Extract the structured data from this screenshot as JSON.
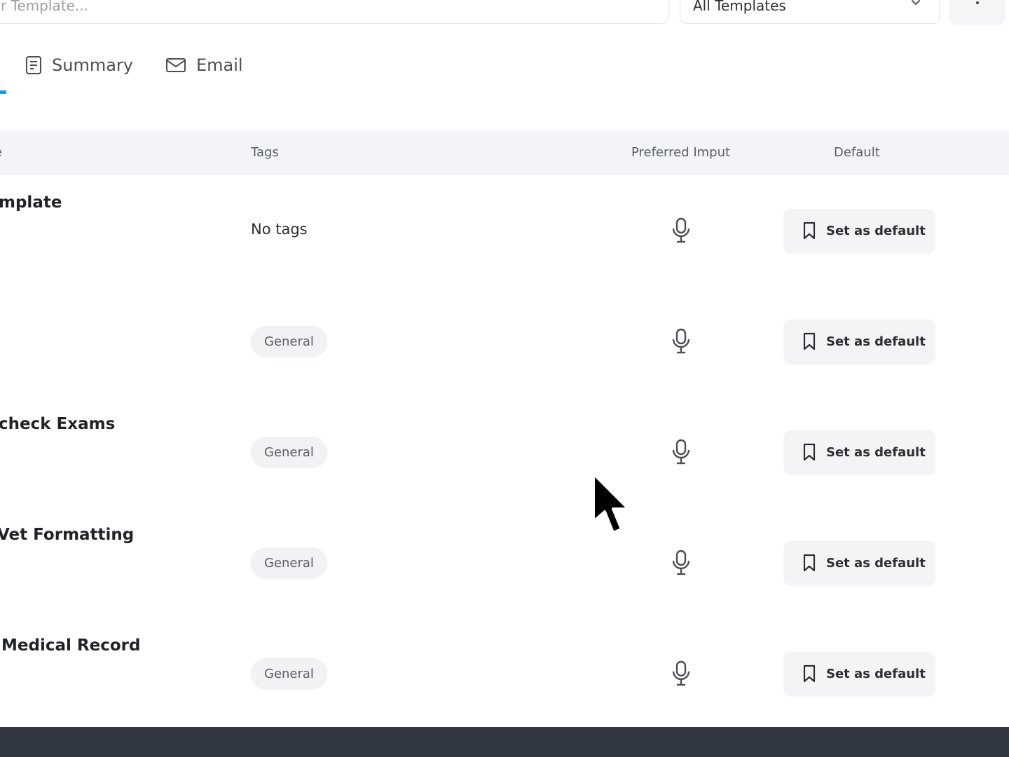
{
  "search": {
    "placeholder": "r Template..."
  },
  "filter": {
    "value": "All Templates"
  },
  "tabs": [
    {
      "label": "Summary",
      "icon": "document-icon"
    },
    {
      "label": "Email",
      "icon": "mail-icon"
    }
  ],
  "table": {
    "headers": {
      "name": "e",
      "tags": "Tags",
      "preferred_input": "Preferred Imput",
      "default": "Default"
    },
    "rows": [
      {
        "name": "mplate",
        "tag": "No tags",
        "tag_is_chip": false,
        "input_icon": "microphone-icon",
        "action": "Set as default"
      },
      {
        "name": "",
        "tag": "General",
        "tag_is_chip": true,
        "input_icon": "microphone-icon",
        "action": "Set as default"
      },
      {
        "name": "check Exams",
        "tag": "General",
        "tag_is_chip": true,
        "input_icon": "microphone-icon",
        "action": "Set as default"
      },
      {
        "name": "Vet Formatting",
        "tag": "General",
        "tag_is_chip": true,
        "input_icon": "microphone-icon",
        "action": "Set as default"
      },
      {
        "name": "Medical Record",
        "tag": "General",
        "tag_is_chip": true,
        "input_icon": "microphone-icon",
        "action": "Set as default"
      }
    ]
  },
  "colors": {
    "accent": "#1a9be0",
    "header_bg": "#f2f4f7",
    "bottom_bar": "#323842"
  }
}
